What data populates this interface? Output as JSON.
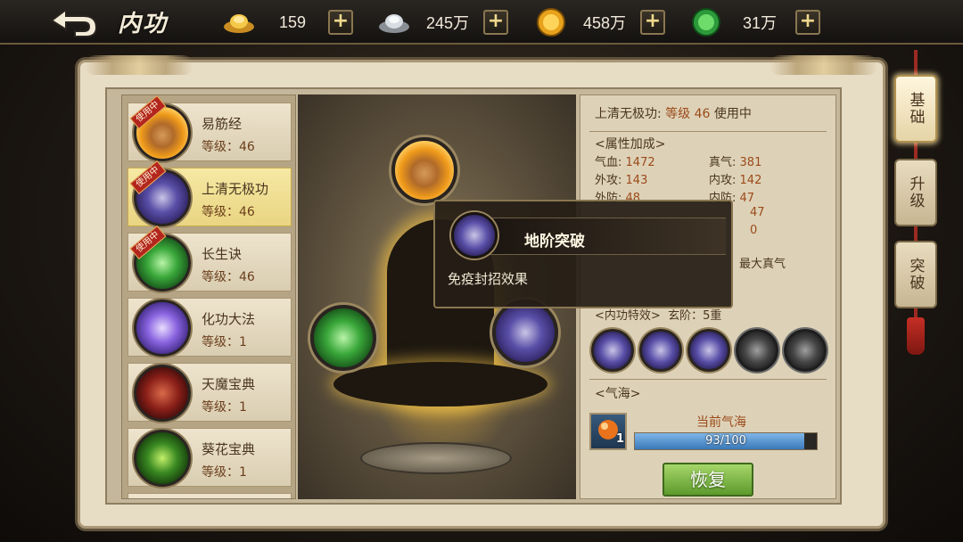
{
  "header": {
    "title": "内功",
    "currencies": [
      {
        "icon": "gold-ingot-icon",
        "value": "159"
      },
      {
        "icon": "silver-ingot-icon",
        "value": "245万"
      },
      {
        "icon": "gold-coin-icon",
        "value": "458万"
      },
      {
        "icon": "green-jade-coin-icon",
        "value": "31万"
      }
    ],
    "plus_label": "+"
  },
  "skills": [
    {
      "name": "易筋经",
      "level": "等级：46",
      "in_use": true,
      "tag": "使用中"
    },
    {
      "name": "上清无极功",
      "level": "等级：46",
      "in_use": true,
      "tag": "使用中",
      "selected": true
    },
    {
      "name": "长生诀",
      "level": "等级：46",
      "in_use": true,
      "tag": "使用中"
    },
    {
      "name": "化功大法",
      "level": "等级：1",
      "in_use": false
    },
    {
      "name": "天魔宝典",
      "level": "等级：1",
      "in_use": false
    },
    {
      "name": "葵花宝典",
      "level": "等级：1",
      "in_use": false
    }
  ],
  "info": {
    "title_name": "上清无极功:",
    "title_level": "等级 46",
    "title_status": "使用中",
    "attr_header": "<属性加成>",
    "stats": [
      {
        "k": "气血:",
        "v": "1472"
      },
      {
        "k": "真气:",
        "v": "381"
      },
      {
        "k": "外攻:",
        "v": "143"
      },
      {
        "k": "内攻:",
        "v": "142"
      },
      {
        "k": "外防:",
        "v": "48"
      },
      {
        "k": "内防:",
        "v": "47"
      },
      {
        "k": "",
        "v": "47"
      },
      {
        "k": "",
        "v": "0"
      }
    ],
    "partial_text": "最大真气",
    "special_header": "<内功特效>",
    "special_rank": "玄阶：5重",
    "qihai_header": "<气海>",
    "qihai_label": "当前气海",
    "orb_count": "1",
    "qihai_value": "93/100",
    "qihai_fraction": 0.93,
    "restore_label": "恢复"
  },
  "tooltip": {
    "title": "地阶突破",
    "desc": "免疫封招效果"
  },
  "tabs": [
    {
      "label": "基础",
      "active": true
    },
    {
      "label": "升级",
      "active": false
    },
    {
      "label": "突破",
      "active": false
    }
  ],
  "colors": {
    "accent_gold": "#f0d98c",
    "level_text": "#9c4a1a",
    "selected_item": "#f6e9a4",
    "progress_blue": "#3a78b8",
    "restore_green": "#5d9a2c",
    "using_tag_red": "#b3261e"
  }
}
